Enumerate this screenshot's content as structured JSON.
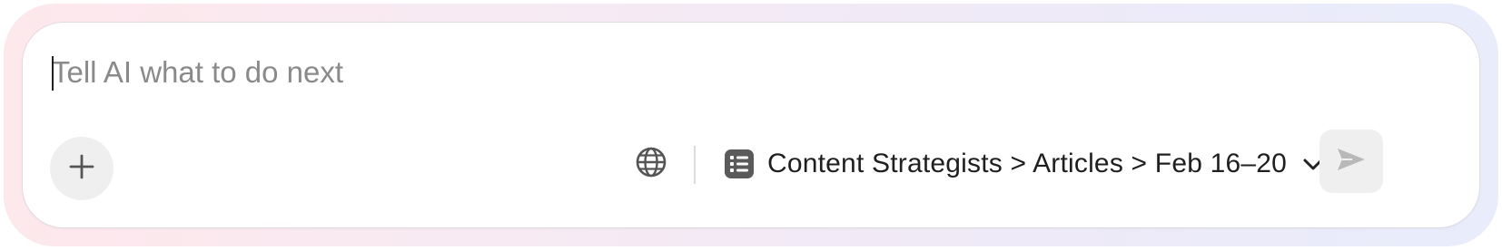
{
  "composer": {
    "placeholder": "Tell AI what to do next",
    "value": ""
  },
  "toolbar": {
    "add_icon": "plus-icon",
    "web_icon": "globe-icon",
    "context": {
      "icon": "list-icon",
      "label": "Content Strategists > Articles > Feb 16–20",
      "dropdown_icon": "chevron-down-icon"
    },
    "send_icon": "send-icon"
  },
  "colors": {
    "glow_left": "#fde8ec",
    "glow_right": "#e8ecfb",
    "button_bg": "#efefef",
    "icon": "#5a5a5a",
    "send_icon": "#b8b8b8"
  }
}
